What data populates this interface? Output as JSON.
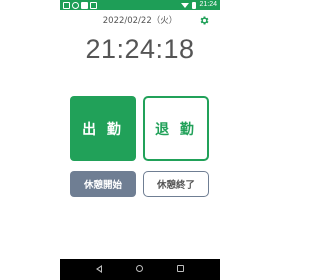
{
  "status_bar": {
    "time": "21:24",
    "icons": [
      "notification-icon",
      "sim-icon",
      "image-icon",
      "card-icon",
      "wifi-icon",
      "battery-icon"
    ]
  },
  "header": {
    "date": "2022/02/22（火）",
    "settings_icon": "gear-icon"
  },
  "clock": {
    "time": "21:24:18"
  },
  "buttons": {
    "check_in": "出 勤",
    "check_out": "退 勤",
    "break_start": "休憩開始",
    "break_end": "休憩終了"
  },
  "nav": {
    "back": "back-icon",
    "home": "home-icon",
    "recents": "recents-icon"
  },
  "colors": {
    "accent": "#21a159",
    "secondary": "#6f7e93",
    "text": "#555555"
  }
}
